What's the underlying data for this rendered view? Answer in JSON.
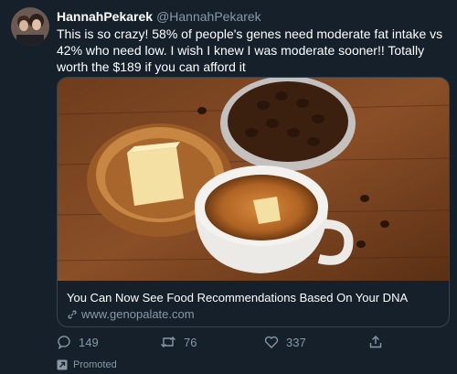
{
  "tweet": {
    "display_name": "HannahPekarek",
    "handle": "@HannahPekarek",
    "text": "This is so crazy! 58% of people's genes need moderate fat intake vs 42% who need low. I wish I knew I was moderate sooner!! Totally worth the $189 if you can afford it"
  },
  "card": {
    "title": "You Can Now See Food Recommendations Based On Your DNA",
    "url": "www.genopalate.com"
  },
  "actions": {
    "replies": "149",
    "retweets": "76",
    "likes": "337"
  },
  "promoted_label": "Promoted",
  "icons": {
    "reply": "reply-icon",
    "retweet": "retweet-icon",
    "like": "heart-icon",
    "share": "share-icon",
    "link": "link-icon",
    "promoted": "promoted-icon"
  },
  "colors": {
    "background": "#15202b",
    "secondary_text": "#8899a6",
    "border": "#38444d"
  }
}
